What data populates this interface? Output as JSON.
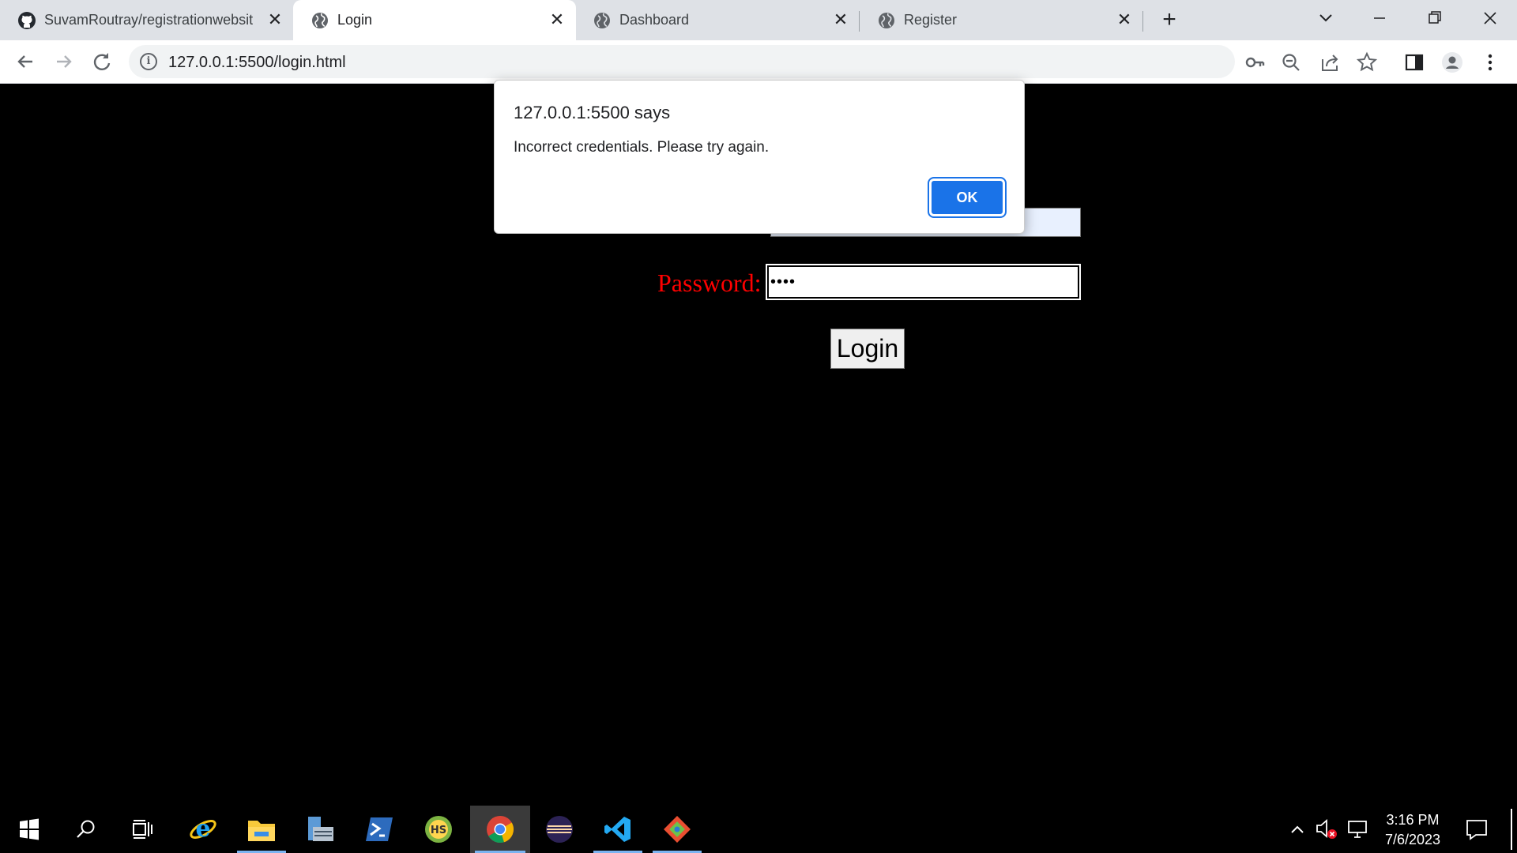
{
  "browser": {
    "tabs": [
      {
        "title": "SuvamRoutray/registrationwebsit",
        "favicon": "github-icon",
        "active": false
      },
      {
        "title": "Login",
        "favicon": "globe-icon",
        "active": true
      },
      {
        "title": "Dashboard",
        "favicon": "globe-icon",
        "active": false
      },
      {
        "title": "Register",
        "favicon": "globe-icon",
        "active": false
      }
    ],
    "url": "127.0.0.1:5500/login.html",
    "close_glyph": "✕",
    "new_tab_glyph": "+"
  },
  "page": {
    "password_label": "Password:",
    "password_value": "••••",
    "login_button": "Login",
    "label_color": "#ff0000"
  },
  "dialog": {
    "origin": "127.0.0.1:5500 says",
    "message": "Incorrect credentials. Please try again.",
    "ok_label": "OK",
    "accent": "#1a73e8"
  },
  "taskbar": {
    "apps": [
      "start-icon",
      "search-icon",
      "task-view-icon",
      "internet-explorer-icon",
      "file-explorer-icon",
      "server-manager-icon",
      "powershell-icon",
      "heidisql-icon",
      "chrome-icon",
      "eclipse-icon",
      "vscode-icon",
      "git-gui-icon"
    ],
    "time": "3:16 PM",
    "date": "7/6/2023"
  }
}
